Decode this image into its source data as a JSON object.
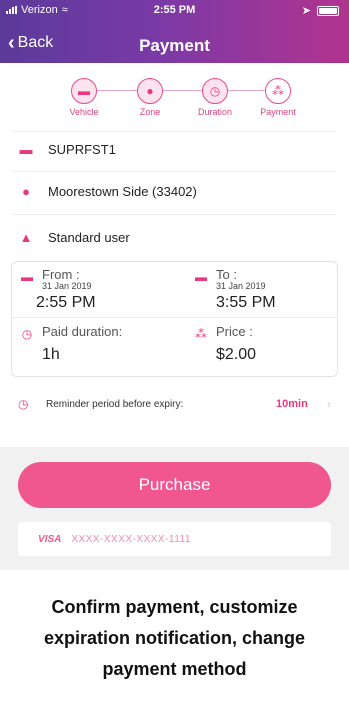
{
  "status_bar": {
    "carrier": "Verizon",
    "time": "2:55 PM"
  },
  "nav": {
    "back_label": "Back",
    "title": "Payment"
  },
  "steps": [
    {
      "label": "Vehicle",
      "icon": "car-icon"
    },
    {
      "label": "Zone",
      "icon": "location-pin-icon"
    },
    {
      "label": "Duration",
      "icon": "clock-icon"
    },
    {
      "label": "Payment",
      "icon": "coins-icon"
    }
  ],
  "details": {
    "vehicle": "SUPRFST1",
    "zone": "Moorestown Side (33402)",
    "user": "Standard user"
  },
  "session": {
    "from_label": "From :",
    "from_date": "31 Jan 2019",
    "from_time": "2:55 PM",
    "to_label": "To :",
    "to_date": "31 Jan 2019",
    "to_time": "3:55 PM",
    "paid_label": "Paid duration:",
    "paid_value": "1h",
    "price_label": "Price :",
    "price_value": "$2.00"
  },
  "reminder": {
    "label": "Reminder period before expiry:",
    "value": "10min"
  },
  "payment": {
    "purchase_label": "Purchase",
    "card_brand": "VISA",
    "card_number": "XXXX-XXXX-XXXX-1111"
  },
  "caption": {
    "line1": "Confirm payment, customize",
    "line2": "expiration notification, change",
    "line3": "payment method"
  },
  "colors": {
    "accent": "#f0578e",
    "header_start": "#5b3a9a",
    "header_end": "#b2338f"
  }
}
